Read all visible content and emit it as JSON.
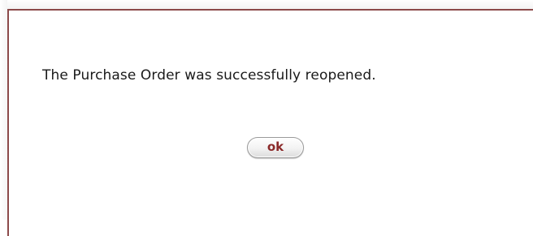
{
  "dialog": {
    "message": "The Purchase Order was successfully reopened.",
    "ok_label": "ok"
  },
  "colors": {
    "border": "#8c4a4a",
    "button_text": "#8b2a2a"
  }
}
